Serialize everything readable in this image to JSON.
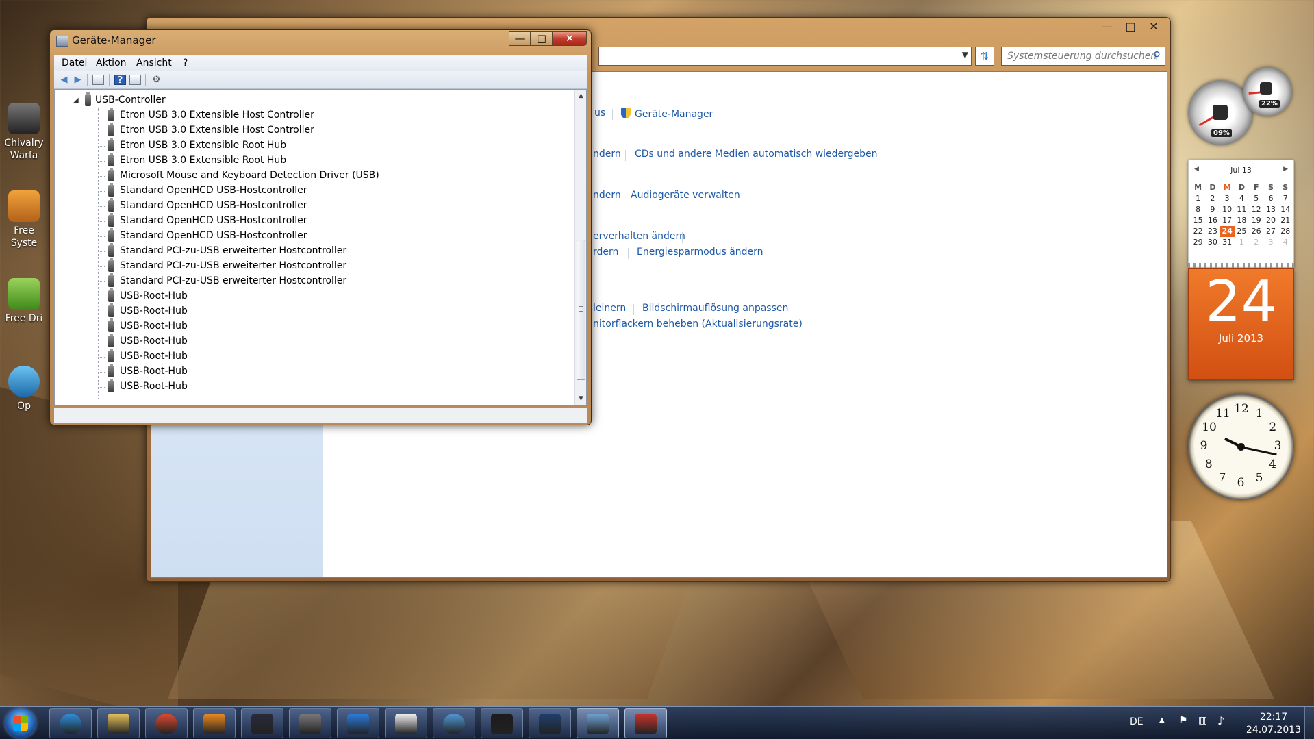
{
  "desktop": {
    "icons": [
      {
        "label1": "Chivalry",
        "label2": "Warfa"
      },
      {
        "label1": "Free Syste",
        "label2": ""
      },
      {
        "label1": "Free Dri",
        "label2": ""
      },
      {
        "label1": "Op",
        "label2": ""
      }
    ]
  },
  "control_panel": {
    "search_placeholder": "Systemsteuerung durchsuchen",
    "links": {
      "frag_us": "us",
      "device_manager": "Geräte-Manager",
      "frag_ndern1": "ndern",
      "autoplay": "CDs und andere Medien automatisch wiedergeben",
      "frag_ndern2": "ndern",
      "audio": "Audiogeräte verwalten",
      "frag_verhalten": "erverhalten ändern",
      "frag_rdern": "rdern",
      "energy": "Energiesparmodus ändern",
      "frag_leinern": "leinern",
      "resolution": "Bildschirmauflösung anpassen",
      "flicker": "nitorflackern beheben (Aktualisierungsrate)"
    }
  },
  "device_manager": {
    "title": "Geräte-Manager",
    "menu": [
      "Datei",
      "Aktion",
      "Ansicht",
      "?"
    ],
    "tree": {
      "category": "USB-Controller",
      "items": [
        "Etron USB 3.0 Extensible Host Controller",
        "Etron USB 3.0 Extensible Host Controller",
        "Etron USB 3.0 Extensible Root Hub",
        "Etron USB 3.0 Extensible Root Hub",
        "Microsoft Mouse and Keyboard Detection Driver (USB)",
        "Standard OpenHCD USB-Hostcontroller",
        "Standard OpenHCD USB-Hostcontroller",
        "Standard OpenHCD USB-Hostcontroller",
        "Standard OpenHCD USB-Hostcontroller",
        "Standard PCI-zu-USB erweiterter Hostcontroller",
        "Standard PCI-zu-USB erweiterter Hostcontroller",
        "Standard PCI-zu-USB erweiterter Hostcontroller",
        "USB-Root-Hub",
        "USB-Root-Hub",
        "USB-Root-Hub",
        "USB-Root-Hub",
        "USB-Root-Hub",
        "USB-Root-Hub",
        "USB-Root-Hub"
      ]
    }
  },
  "gadgets": {
    "cpu_gauge": "09%",
    "mem_gauge": "22%",
    "calendar": {
      "month_label": "Jul 13",
      "weekdays": [
        "M",
        "D",
        "M",
        "D",
        "F",
        "S",
        "S"
      ],
      "weeks": [
        [
          "1",
          "2",
          "3",
          "4",
          "5",
          "6",
          "7"
        ],
        [
          "8",
          "9",
          "10",
          "11",
          "12",
          "13",
          "14"
        ],
        [
          "15",
          "16",
          "17",
          "18",
          "19",
          "20",
          "21"
        ],
        [
          "22",
          "23",
          "24",
          "25",
          "26",
          "27",
          "28"
        ],
        [
          "29",
          "30",
          "31",
          "1",
          "2",
          "3",
          "4"
        ]
      ],
      "today": "24",
      "today_month": "Juli 2013"
    },
    "clock_numerals": [
      "12",
      "1",
      "2",
      "3",
      "4",
      "5",
      "6",
      "7",
      "8",
      "9",
      "10",
      "11"
    ]
  },
  "taskbar": {
    "language": "DE",
    "time": "22:17",
    "date": "24.07.2013",
    "app_colors": [
      "#2f8fde",
      "#e7c35b",
      "#e04a2f",
      "#f08b1e",
      "#2a2a3a",
      "#7a7a7a",
      "#2a7de0",
      "#f2f2f2",
      "#4f9ad8",
      "#1b1b1b",
      "#1f3f6b",
      "#6fa5d6",
      "#c8342c"
    ]
  }
}
